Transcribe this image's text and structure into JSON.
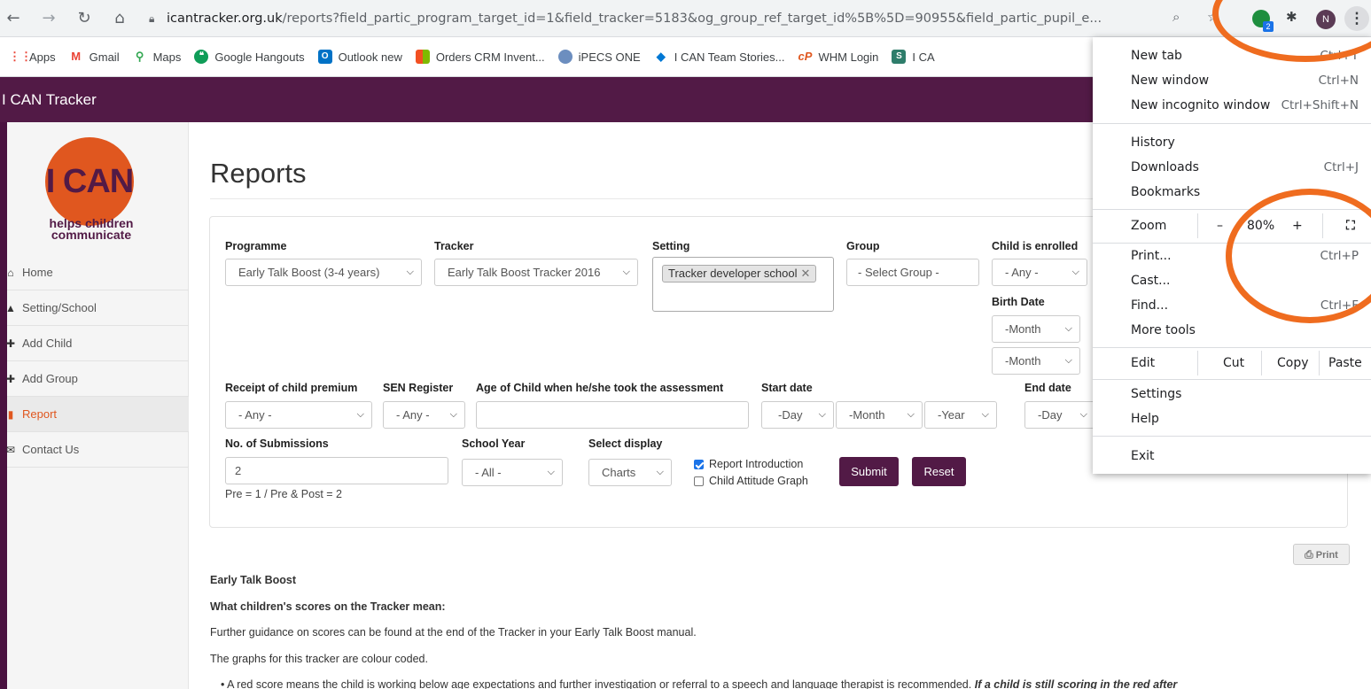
{
  "browser": {
    "url_host": "icantracker.org.uk",
    "url_path": "/reports?field_partic_program_target_id=1&field_tracker=5183&og_group_ref_target_id%5B%5D=90955&field_partic_pupil_e...",
    "profile_initial": "N",
    "extension_badge": "2",
    "bookmarks": [
      {
        "label": "Apps",
        "color": "#4285f4",
        "icon": "apps-grid-icon"
      },
      {
        "label": "Gmail",
        "color": "#ea4335",
        "icon": "gmail-icon"
      },
      {
        "label": "Maps",
        "color": "#34a853",
        "icon": "maps-pin-icon"
      },
      {
        "label": "Google Hangouts",
        "color": "#0f9d58",
        "icon": "hangouts-icon"
      },
      {
        "label": "Outlook new",
        "color": "#0072c6",
        "icon": "outlook-icon"
      },
      {
        "label": "Orders CRM Invent...",
        "color": "#f25022",
        "icon": "microsoft-icon"
      },
      {
        "label": "iPECS ONE",
        "color": "#6c8ebf",
        "icon": "ipecs-icon"
      },
      {
        "label": "I CAN Team Stories...",
        "color": "#0078d4",
        "icon": "azure-icon"
      },
      {
        "label": "WHM Login",
        "color": "#e0571f",
        "icon": "cpanel-icon"
      },
      {
        "label": "I CA",
        "color": "#2e7d6b",
        "icon": "sharepoint-icon"
      }
    ]
  },
  "site": {
    "header_title": "I CAN Tracker",
    "logo_text": "I CAN",
    "logo_tagline": "helps children communicate",
    "nav": [
      {
        "label": "Home",
        "icon": "home-icon",
        "glyph": "⌂",
        "active": false
      },
      {
        "label": "Setting/School",
        "icon": "bell-icon",
        "glyph": "▲",
        "active": false
      },
      {
        "label": "Add Child",
        "icon": "plus-icon",
        "glyph": "✚",
        "active": false
      },
      {
        "label": "Add Group",
        "icon": "plus-icon",
        "glyph": "✚",
        "active": false
      },
      {
        "label": "Report",
        "icon": "bar-chart-icon",
        "glyph": "▮",
        "active": true
      },
      {
        "label": "Contact Us",
        "icon": "envelope-icon",
        "glyph": "✉",
        "active": false
      }
    ]
  },
  "reports": {
    "title": "Reports",
    "programme": {
      "label": "Programme",
      "value": "Early Talk Boost (3-4 years)"
    },
    "tracker": {
      "label": "Tracker",
      "value": "Early Talk Boost Tracker 2016"
    },
    "setting": {
      "label": "Setting",
      "tag": "Tracker developer school"
    },
    "group": {
      "label": "Group",
      "value": "- Select Group -"
    },
    "enrolled": {
      "label": "Child is enrolled",
      "value": "- Any -"
    },
    "birth_date": {
      "label": "Birth Date",
      "month1": "-Month",
      "month2": "-Month"
    },
    "child_premium": {
      "label": "Receipt of child premium",
      "value": "- Any -"
    },
    "sen": {
      "label": "SEN Register",
      "value": "- Any -"
    },
    "age": {
      "label": "Age of Child when he/she took the assessment",
      "value": ""
    },
    "start_date": {
      "label": "Start date",
      "day": "-Day",
      "month": "-Month",
      "year": "-Year"
    },
    "end_date": {
      "label": "End date",
      "day": "-Day"
    },
    "submissions": {
      "label": "No. of Submissions",
      "value": "2",
      "help": "Pre = 1 / Pre & Post = 2"
    },
    "school_year": {
      "label": "School Year",
      "value": "- All -"
    },
    "display": {
      "label": "Select display",
      "value": "Charts"
    },
    "report_intro": {
      "label": "Report Introduction",
      "checked": true
    },
    "attitude_graph": {
      "label": "Child Attitude Graph",
      "checked": false
    },
    "submit": "Submit",
    "reset": "Reset",
    "print": "Print"
  },
  "body_text": {
    "heading": "Early Talk Boost",
    "subheading": "What children's scores on the Tracker mean:",
    "p1": "Further guidance on scores can be found at the end of the Tracker in your Early Talk Boost manual.",
    "p2": "The graphs for this tracker are colour coded.",
    "bullet": "A red score means the child is working below age expectations and further investigation or referral to a speech and language therapist is recommended.",
    "bullet_emph": "If a child is still scoring in the red after"
  },
  "chrome_menu": {
    "new_tab": {
      "label": "New tab",
      "shortcut": "Ctrl+T"
    },
    "new_window": {
      "label": "New window",
      "shortcut": "Ctrl+N"
    },
    "incognito": {
      "label": "New incognito window",
      "shortcut": "Ctrl+Shift+N"
    },
    "history": "History",
    "downloads": {
      "label": "Downloads",
      "shortcut": "Ctrl+J"
    },
    "bookmarks": "Bookmarks",
    "zoom": {
      "label": "Zoom",
      "minus": "–",
      "level": "80%",
      "plus": "+"
    },
    "print": {
      "label": "Print...",
      "shortcut": "Ctrl+P"
    },
    "cast": "Cast...",
    "find": {
      "label": "Find...",
      "shortcut": "Ctrl+F"
    },
    "more_tools": "More tools",
    "edit": {
      "label": "Edit",
      "cut": "Cut",
      "copy": "Copy",
      "paste": "Paste"
    },
    "settings": "Settings",
    "help": "Help",
    "exit": "Exit"
  },
  "colors": {
    "brand": "#521a46",
    "accent": "#e0571f",
    "annotation": "#ef6c1f"
  }
}
